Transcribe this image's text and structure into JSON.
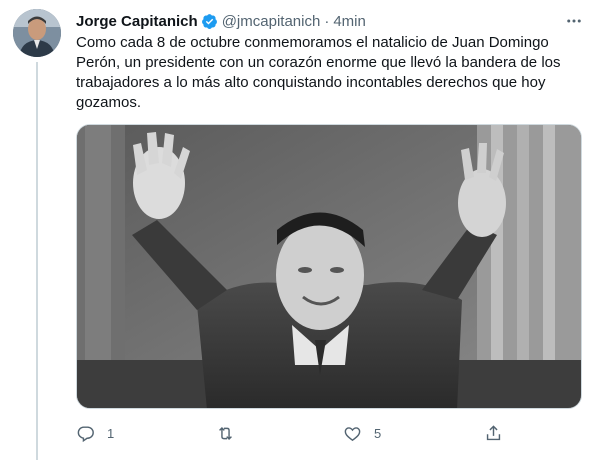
{
  "author": {
    "name": "Jorge Capitanich",
    "handle": "@jmcapitanich",
    "separator": "·",
    "time": "4min",
    "verified_icon": "verified-badge-icon"
  },
  "tweet": {
    "text": "Como cada 8 de octubre conmemoramos el natalicio de Juan Domingo Perón, un presidente con un corazón enorme que llevó la bandera de los trabajadores a lo más alto conquistando incontables derechos que hoy gozamos.",
    "media_kind": "black-and-white photograph"
  },
  "actions": {
    "reply_count": "1",
    "retweet_count": "",
    "like_count": "5",
    "icons": [
      "reply-icon",
      "retweet-icon",
      "like-icon",
      "share-icon"
    ]
  },
  "colors": {
    "text": "#0f1419",
    "secondary": "#536471",
    "verified": "#1d9bf0",
    "border": "#cfd9de"
  }
}
